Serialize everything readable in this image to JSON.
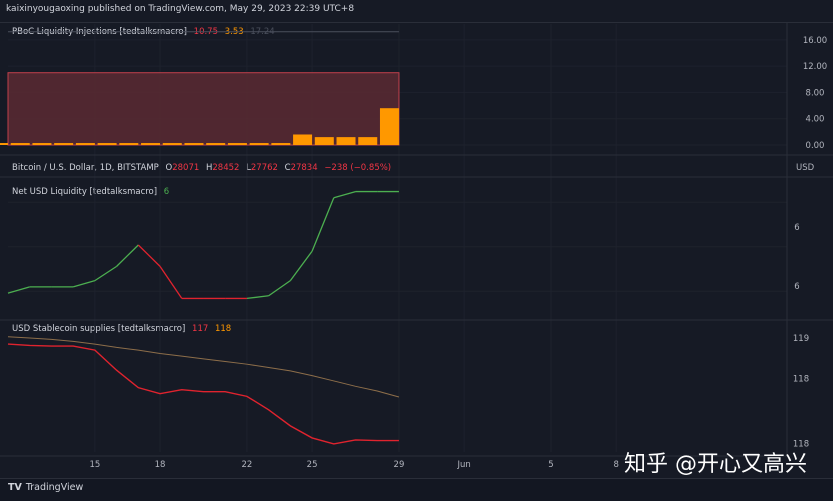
{
  "header": {
    "publisher": "kaixinyougaoxing published on TradingView.com, May 29, 2023 22:39 UTC+8"
  },
  "pane1": {
    "title": "PBoC Liquidity Injections [tedtalksmacro]",
    "values": [
      "10.75",
      "3.53",
      "17.24"
    ],
    "value_colors": [
      "#f23645",
      "#ff9800",
      "#4a4f5c"
    ],
    "yticks": [
      "16.00",
      "12.00",
      "8.00",
      "4.00",
      "0.00"
    ]
  },
  "pane2": {
    "symbol": "Bitcoin / U.S. Dollar, 1D, BITSTAMP",
    "ohlc": [
      {
        "k": "O",
        "v": "28071"
      },
      {
        "k": "H",
        "v": "28452"
      },
      {
        "k": "L",
        "v": "27762"
      },
      {
        "k": "C",
        "v": "27834"
      }
    ],
    "change": "−238 (−0.85%)",
    "currency": "USD",
    "indicator_title": "Net USD Liquidity [tedtalksmacro]",
    "indicator_value": "6",
    "yticks": [
      "6",
      "6"
    ]
  },
  "pane3": {
    "title": "USD Stablecoin supplies [tedtalksmacro]",
    "values": [
      "117",
      "118"
    ],
    "yticks": [
      "119",
      "118",
      "118"
    ]
  },
  "xaxis": {
    "ticks": [
      "15",
      "18",
      "22",
      "25",
      "29",
      "Jun",
      "5",
      "8"
    ]
  },
  "footer": {
    "brand": "TradingView",
    "watermark": "知乎 @开心又高兴"
  },
  "colors": {
    "green": "#4caf50",
    "red": "#e0232e",
    "orange": "#ff9800",
    "brown": "#8d6e4a",
    "bg": "#161a25"
  },
  "chart_data": [
    {
      "type": "bar",
      "title": "PBoC Liquidity Injections [tedtalksmacro]",
      "x": [
        "11",
        "12",
        "13",
        "14",
        "15",
        "16",
        "17",
        "18",
        "19",
        "20",
        "21",
        "22",
        "23",
        "24",
        "25",
        "26",
        "27",
        "28",
        "29"
      ],
      "values": [
        0.3,
        0.3,
        0.3,
        0.3,
        0.3,
        0.3,
        0.3,
        0.3,
        0.3,
        0.3,
        0.3,
        0.3,
        0.3,
        0.3,
        1.6,
        1.2,
        1.2,
        1.2,
        5.6
      ],
      "band": [
        0,
        11.0
      ],
      "ylim": [
        0,
        17.5
      ]
    },
    {
      "type": "line",
      "title": "Net USD Liquidity [tedtalksmacro]",
      "x": [
        "11",
        "12",
        "13",
        "14",
        "15",
        "16",
        "17",
        "18",
        "19",
        "20",
        "21",
        "22",
        "23",
        "24",
        "25",
        "26",
        "27",
        "28",
        "29"
      ],
      "values": [
        5.58,
        5.65,
        5.65,
        5.65,
        5.72,
        5.88,
        6.12,
        5.88,
        5.52,
        5.52,
        5.52,
        5.52,
        5.55,
        5.72,
        6.05,
        6.65,
        6.72,
        6.72,
        6.72
      ],
      "segment_colors": [
        "green",
        "green",
        "green",
        "green",
        "green",
        "green",
        "red",
        "red",
        "red",
        "red",
        "red",
        "green",
        "green",
        "green",
        "green",
        "green",
        "green",
        "green"
      ],
      "ylim": [
        5.3,
        6.85
      ]
    },
    {
      "type": "line",
      "title": "USD Stablecoin supplies [tedtalksmacro]",
      "x": [
        "11",
        "12",
        "13",
        "14",
        "15",
        "16",
        "17",
        "18",
        "19",
        "20",
        "21",
        "22",
        "23",
        "24",
        "25",
        "26",
        "27",
        "28",
        "29"
      ],
      "series": [
        {
          "color": "#e0232e",
          "values": [
            118.86,
            118.84,
            118.83,
            118.83,
            118.77,
            118.47,
            118.21,
            118.12,
            118.18,
            118.15,
            118.15,
            118.08,
            117.88,
            117.64,
            117.46,
            117.37,
            117.43,
            117.42,
            117.42
          ]
        },
        {
          "color": "#8d6e4a",
          "values": [
            118.97,
            118.95,
            118.93,
            118.9,
            118.86,
            118.81,
            118.77,
            118.72,
            118.68,
            118.64,
            118.6,
            118.56,
            118.51,
            118.46,
            118.39,
            118.31,
            118.23,
            118.16,
            118.07
          ]
        }
      ],
      "ylim": [
        117.25,
        119.07
      ]
    }
  ]
}
